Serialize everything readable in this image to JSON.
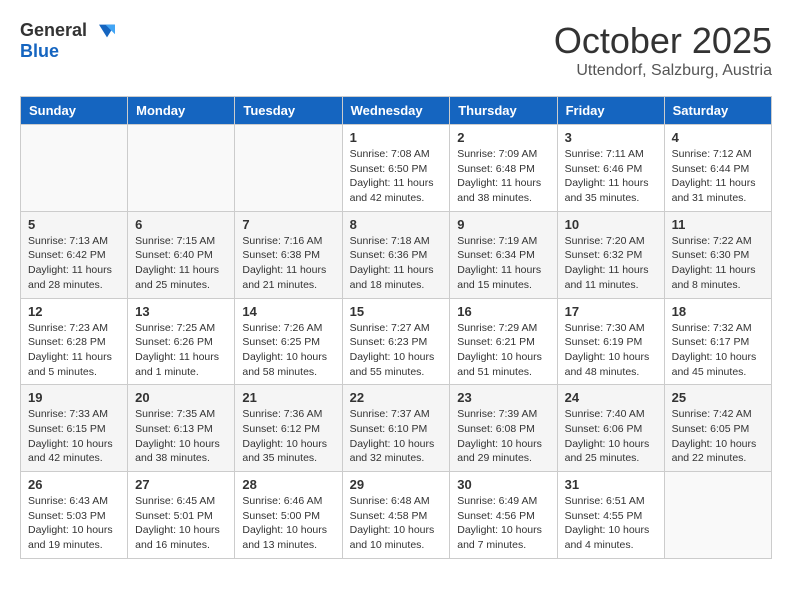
{
  "header": {
    "logo_general": "General",
    "logo_blue": "Blue",
    "month": "October 2025",
    "location": "Uttendorf, Salzburg, Austria"
  },
  "days_of_week": [
    "Sunday",
    "Monday",
    "Tuesday",
    "Wednesday",
    "Thursday",
    "Friday",
    "Saturday"
  ],
  "weeks": [
    [
      {
        "day": "",
        "info": ""
      },
      {
        "day": "",
        "info": ""
      },
      {
        "day": "",
        "info": ""
      },
      {
        "day": "1",
        "info": "Sunrise: 7:08 AM\nSunset: 6:50 PM\nDaylight: 11 hours\nand 42 minutes."
      },
      {
        "day": "2",
        "info": "Sunrise: 7:09 AM\nSunset: 6:48 PM\nDaylight: 11 hours\nand 38 minutes."
      },
      {
        "day": "3",
        "info": "Sunrise: 7:11 AM\nSunset: 6:46 PM\nDaylight: 11 hours\nand 35 minutes."
      },
      {
        "day": "4",
        "info": "Sunrise: 7:12 AM\nSunset: 6:44 PM\nDaylight: 11 hours\nand 31 minutes."
      }
    ],
    [
      {
        "day": "5",
        "info": "Sunrise: 7:13 AM\nSunset: 6:42 PM\nDaylight: 11 hours\nand 28 minutes."
      },
      {
        "day": "6",
        "info": "Sunrise: 7:15 AM\nSunset: 6:40 PM\nDaylight: 11 hours\nand 25 minutes."
      },
      {
        "day": "7",
        "info": "Sunrise: 7:16 AM\nSunset: 6:38 PM\nDaylight: 11 hours\nand 21 minutes."
      },
      {
        "day": "8",
        "info": "Sunrise: 7:18 AM\nSunset: 6:36 PM\nDaylight: 11 hours\nand 18 minutes."
      },
      {
        "day": "9",
        "info": "Sunrise: 7:19 AM\nSunset: 6:34 PM\nDaylight: 11 hours\nand 15 minutes."
      },
      {
        "day": "10",
        "info": "Sunrise: 7:20 AM\nSunset: 6:32 PM\nDaylight: 11 hours\nand 11 minutes."
      },
      {
        "day": "11",
        "info": "Sunrise: 7:22 AM\nSunset: 6:30 PM\nDaylight: 11 hours\nand 8 minutes."
      }
    ],
    [
      {
        "day": "12",
        "info": "Sunrise: 7:23 AM\nSunset: 6:28 PM\nDaylight: 11 hours\nand 5 minutes."
      },
      {
        "day": "13",
        "info": "Sunrise: 7:25 AM\nSunset: 6:26 PM\nDaylight: 11 hours\nand 1 minute."
      },
      {
        "day": "14",
        "info": "Sunrise: 7:26 AM\nSunset: 6:25 PM\nDaylight: 10 hours\nand 58 minutes."
      },
      {
        "day": "15",
        "info": "Sunrise: 7:27 AM\nSunset: 6:23 PM\nDaylight: 10 hours\nand 55 minutes."
      },
      {
        "day": "16",
        "info": "Sunrise: 7:29 AM\nSunset: 6:21 PM\nDaylight: 10 hours\nand 51 minutes."
      },
      {
        "day": "17",
        "info": "Sunrise: 7:30 AM\nSunset: 6:19 PM\nDaylight: 10 hours\nand 48 minutes."
      },
      {
        "day": "18",
        "info": "Sunrise: 7:32 AM\nSunset: 6:17 PM\nDaylight: 10 hours\nand 45 minutes."
      }
    ],
    [
      {
        "day": "19",
        "info": "Sunrise: 7:33 AM\nSunset: 6:15 PM\nDaylight: 10 hours\nand 42 minutes."
      },
      {
        "day": "20",
        "info": "Sunrise: 7:35 AM\nSunset: 6:13 PM\nDaylight: 10 hours\nand 38 minutes."
      },
      {
        "day": "21",
        "info": "Sunrise: 7:36 AM\nSunset: 6:12 PM\nDaylight: 10 hours\nand 35 minutes."
      },
      {
        "day": "22",
        "info": "Sunrise: 7:37 AM\nSunset: 6:10 PM\nDaylight: 10 hours\nand 32 minutes."
      },
      {
        "day": "23",
        "info": "Sunrise: 7:39 AM\nSunset: 6:08 PM\nDaylight: 10 hours\nand 29 minutes."
      },
      {
        "day": "24",
        "info": "Sunrise: 7:40 AM\nSunset: 6:06 PM\nDaylight: 10 hours\nand 25 minutes."
      },
      {
        "day": "25",
        "info": "Sunrise: 7:42 AM\nSunset: 6:05 PM\nDaylight: 10 hours\nand 22 minutes."
      }
    ],
    [
      {
        "day": "26",
        "info": "Sunrise: 6:43 AM\nSunset: 5:03 PM\nDaylight: 10 hours\nand 19 minutes."
      },
      {
        "day": "27",
        "info": "Sunrise: 6:45 AM\nSunset: 5:01 PM\nDaylight: 10 hours\nand 16 minutes."
      },
      {
        "day": "28",
        "info": "Sunrise: 6:46 AM\nSunset: 5:00 PM\nDaylight: 10 hours\nand 13 minutes."
      },
      {
        "day": "29",
        "info": "Sunrise: 6:48 AM\nSunset: 4:58 PM\nDaylight: 10 hours\nand 10 minutes."
      },
      {
        "day": "30",
        "info": "Sunrise: 6:49 AM\nSunset: 4:56 PM\nDaylight: 10 hours\nand 7 minutes."
      },
      {
        "day": "31",
        "info": "Sunrise: 6:51 AM\nSunset: 4:55 PM\nDaylight: 10 hours\nand 4 minutes."
      },
      {
        "day": "",
        "info": ""
      }
    ]
  ]
}
